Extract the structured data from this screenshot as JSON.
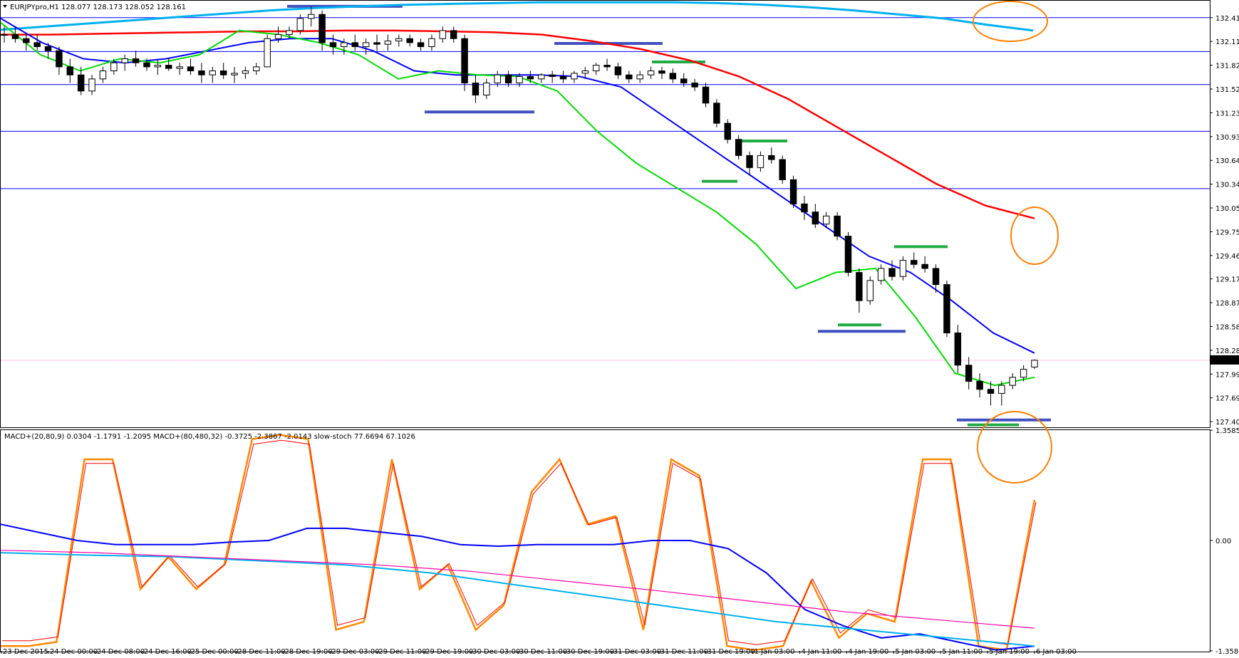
{
  "main_title": "EURJPYpro,H1  128.077 128.173 128.052 128.161",
  "price_axis_labels": [
    "132.410",
    "132.115",
    "131.820",
    "131.525",
    "131.230",
    "130.935",
    "130.640",
    "130.345",
    "130.050",
    "129.755",
    "129.460",
    "129.170",
    "128.875",
    "128.580",
    "128.285",
    "127.990",
    "127.695",
    "127.400"
  ],
  "current_price": "128.161",
  "indicator_title": "MACD+(20,80,9) 0.0304 -1.1791 -1.2095  MACD+(80,480,32) -0.3725 -2.3867 -2.0143  slow-stoch 77.6694 67.1026",
  "indicator_axis_labels": [
    "1.3585",
    "0.00",
    "-1.3585"
  ],
  "time_labels": [
    "23 Dec 2015",
    "24 Dec 00:00",
    "24 Dec 08:00",
    "24 Dec 16:00",
    "25 Dec 00:00",
    "28 Dec 11:00",
    "28 Dec 19:00",
    "29 Dec 03:00",
    "29 Dec 11:00",
    "29 Dec 19:00",
    "30 Dec 03:00",
    "30 Dec 11:00",
    "30 Dec 19:00",
    "31 Dec 03:00",
    "31 Dec 11:00",
    "31 Dec 19:00",
    "1 Jan 03:00",
    "4 Jan 11:00",
    "4 Jan 19:00",
    "5 Jan 03:00",
    "5 Jan 11:00",
    "5 Jan 19:00",
    "6 Jan 03:00"
  ],
  "colors": {
    "bull_candle": "#ffffff",
    "bear_candle": "#000000",
    "ema_fast": "#00dd00",
    "ema_mid": "#0000ff",
    "ema_slow": "#ff0000",
    "ma_long": "#00b0f0",
    "bands": "#0000ff",
    "levels": "#0000ff",
    "resistance_marks": "#4050c0",
    "support_marks": "#22aa44",
    "highlight_circles": "#ff7f00",
    "stoch_main": "#ff8800",
    "stoch_signal": "#ff0000",
    "macd_slow_signal": "#ff00aa",
    "price_line": "#ff88cc"
  },
  "chart_data": [
    {
      "type": "candlestick",
      "title": "EURJPYpro,H1",
      "ylim": [
        127.33,
        132.62
      ],
      "levels": [
        132.41,
        131.99,
        131.58,
        131.0,
        130.29
      ],
      "candles": [
        [
          132.2,
          132.3,
          132.1,
          132.2
        ],
        [
          132.2,
          132.3,
          132.1,
          132.15
        ],
        [
          132.15,
          132.2,
          132.0,
          132.1
        ],
        [
          132.1,
          132.2,
          132.0,
          132.05
        ],
        [
          132.05,
          132.1,
          131.9,
          132.0
        ],
        [
          132.0,
          132.05,
          131.7,
          131.8
        ],
        [
          131.8,
          131.9,
          131.6,
          131.7
        ],
        [
          131.7,
          131.8,
          131.45,
          131.5
        ],
        [
          131.5,
          131.7,
          131.45,
          131.65
        ],
        [
          131.65,
          131.8,
          131.6,
          131.75
        ],
        [
          131.75,
          131.9,
          131.7,
          131.85
        ],
        [
          131.85,
          131.95,
          131.75,
          131.9
        ],
        [
          131.9,
          132.0,
          131.8,
          131.85
        ],
        [
          131.85,
          131.9,
          131.75,
          131.8
        ],
        [
          131.8,
          131.9,
          131.7,
          131.82
        ],
        [
          131.82,
          131.9,
          131.75,
          131.78
        ],
        [
          131.78,
          131.85,
          131.7,
          131.8
        ],
        [
          131.8,
          131.9,
          131.7,
          131.75
        ],
        [
          131.75,
          131.85,
          131.6,
          131.7
        ],
        [
          131.7,
          131.8,
          131.6,
          131.75
        ],
        [
          131.75,
          131.85,
          131.65,
          131.7
        ],
        [
          131.7,
          131.8,
          131.6,
          131.72
        ],
        [
          131.72,
          131.8,
          131.65,
          131.75
        ],
        [
          131.75,
          131.85,
          131.7,
          131.8
        ],
        [
          131.8,
          132.2,
          131.8,
          132.15
        ],
        [
          132.15,
          132.3,
          132.1,
          132.2
        ],
        [
          132.2,
          132.3,
          132.15,
          132.25
        ],
        [
          132.25,
          132.45,
          132.2,
          132.4
        ],
        [
          132.4,
          132.55,
          132.3,
          132.45
        ],
        [
          132.45,
          132.5,
          132.0,
          132.1
        ],
        [
          132.1,
          132.2,
          131.95,
          132.05
        ],
        [
          132.05,
          132.15,
          131.95,
          132.1
        ],
        [
          132.1,
          132.2,
          132.0,
          132.05
        ],
        [
          132.05,
          132.15,
          131.95,
          132.1
        ],
        [
          132.1,
          132.2,
          132.0,
          132.08
        ],
        [
          132.08,
          132.2,
          132.0,
          132.12
        ],
        [
          132.12,
          132.2,
          132.05,
          132.15
        ],
        [
          132.15,
          132.2,
          132.05,
          132.1
        ],
        [
          132.1,
          132.15,
          132.0,
          132.05
        ],
        [
          132.05,
          132.2,
          132.0,
          132.15
        ],
        [
          132.15,
          132.3,
          132.1,
          132.25
        ],
        [
          132.25,
          132.3,
          132.1,
          132.15
        ],
        [
          132.15,
          132.2,
          131.5,
          131.6
        ],
        [
          131.6,
          131.7,
          131.35,
          131.45
        ],
        [
          131.45,
          131.65,
          131.4,
          131.6
        ],
        [
          131.6,
          131.75,
          131.55,
          131.7
        ],
        [
          131.7,
          131.75,
          131.55,
          131.6
        ],
        [
          131.6,
          131.72,
          131.55,
          131.68
        ],
        [
          131.68,
          131.75,
          131.6,
          131.65
        ],
        [
          131.65,
          131.72,
          131.6,
          131.7
        ],
        [
          131.7,
          131.75,
          131.6,
          131.68
        ],
        [
          131.68,
          131.75,
          131.6,
          131.65
        ],
        [
          131.65,
          131.75,
          131.6,
          131.72
        ],
        [
          131.72,
          131.8,
          131.65,
          131.75
        ],
        [
          131.75,
          131.85,
          131.7,
          131.82
        ],
        [
          131.82,
          131.9,
          131.75,
          131.8
        ],
        [
          131.8,
          131.85,
          131.65,
          131.7
        ],
        [
          131.7,
          131.75,
          131.6,
          131.65
        ],
        [
          131.65,
          131.75,
          131.6,
          131.7
        ],
        [
          131.7,
          131.8,
          131.65,
          131.75
        ],
        [
          131.75,
          131.8,
          131.65,
          131.72
        ],
        [
          131.72,
          131.78,
          131.6,
          131.65
        ],
        [
          131.65,
          131.72,
          131.55,
          131.6
        ],
        [
          131.6,
          131.65,
          131.5,
          131.55
        ],
        [
          131.55,
          131.6,
          131.3,
          131.35
        ],
        [
          131.35,
          131.4,
          131.05,
          131.1
        ],
        [
          131.1,
          131.15,
          130.85,
          130.9
        ],
        [
          130.9,
          130.95,
          130.65,
          130.7
        ],
        [
          130.7,
          130.75,
          130.45,
          130.55
        ],
        [
          130.55,
          130.75,
          130.5,
          130.7
        ],
        [
          130.7,
          130.8,
          130.6,
          130.65
        ],
        [
          130.65,
          130.7,
          130.35,
          130.4
        ],
        [
          130.4,
          130.45,
          130.05,
          130.1
        ],
        [
          130.1,
          130.2,
          129.9,
          130.0
        ],
        [
          130.0,
          130.1,
          129.8,
          129.85
        ],
        [
          129.85,
          130.0,
          129.8,
          129.95
        ],
        [
          129.95,
          130.0,
          129.65,
          129.7
        ],
        [
          129.7,
          129.75,
          129.2,
          129.25
        ],
        [
          129.25,
          129.3,
          128.75,
          128.9
        ],
        [
          128.9,
          129.2,
          128.85,
          129.15
        ],
        [
          129.15,
          129.35,
          129.1,
          129.3
        ],
        [
          129.3,
          129.4,
          129.15,
          129.2
        ],
        [
          129.2,
          129.45,
          129.15,
          129.4
        ],
        [
          129.4,
          129.5,
          129.3,
          129.35
        ],
        [
          129.35,
          129.45,
          129.25,
          129.3
        ],
        [
          129.3,
          129.35,
          129.0,
          129.1
        ],
        [
          129.1,
          129.15,
          128.45,
          128.5
        ],
        [
          128.5,
          128.6,
          128.0,
          128.1
        ],
        [
          128.1,
          128.2,
          127.8,
          127.9
        ],
        [
          127.9,
          128.0,
          127.7,
          127.8
        ],
        [
          127.8,
          127.9,
          127.6,
          127.75
        ],
        [
          127.75,
          127.9,
          127.6,
          127.85
        ],
        [
          127.85,
          128.0,
          127.8,
          127.95
        ],
        [
          127.95,
          128.1,
          127.9,
          128.05
        ],
        [
          128.077,
          128.173,
          128.052,
          128.161
        ]
      ],
      "ma_slow": [
        132.2,
        132.2,
        132.21,
        132.22,
        132.23,
        132.24,
        132.24,
        132.25,
        132.25,
        132.24,
        132.23,
        132.2,
        132.12,
        132.02,
        131.88,
        131.68,
        131.4,
        131.05,
        130.7,
        130.35,
        130.08,
        129.92
      ],
      "ma_long": [
        132.26,
        132.3,
        132.34,
        132.38,
        132.42,
        132.46,
        132.5,
        132.53,
        132.55,
        132.57,
        132.58,
        132.59,
        132.6,
        132.6,
        132.6,
        132.6,
        132.59,
        132.57,
        132.54,
        132.5,
        132.45,
        132.4,
        132.32,
        132.25
      ],
      "ema_mid": [
        132.4,
        132.1,
        131.9,
        131.85,
        131.9,
        132.0,
        132.1,
        132.15,
        132.15,
        132.0,
        131.75,
        131.7,
        131.7,
        131.7,
        131.68,
        131.55,
        131.2,
        130.85,
        130.5,
        130.15,
        129.8,
        129.45,
        129.25,
        128.9,
        128.5,
        128.25
      ],
      "ema_fast": [
        132.35,
        131.95,
        131.75,
        131.9,
        131.85,
        131.95,
        132.25,
        132.2,
        132.1,
        131.95,
        131.65,
        131.75,
        131.7,
        131.68,
        131.5,
        131.0,
        130.6,
        130.3,
        130.0,
        129.6,
        129.05,
        129.25,
        129.3,
        128.7,
        128.0,
        127.85,
        127.95
      ]
    },
    {
      "type": "line",
      "title": "MACD+(20,80,9) / MACD+(80,480,32) / slow-stoch",
      "ylim": [
        -1.36,
        1.36
      ],
      "series": [
        {
          "name": "slow-stoch",
          "values": [
            -1.3,
            -1.3,
            -1.25,
            1.0,
            1.0,
            -0.6,
            -0.2,
            -0.6,
            -0.3,
            1.25,
            1.3,
            1.25,
            -1.1,
            -1.0,
            1.0,
            -0.6,
            -0.3,
            -1.1,
            -0.8,
            0.6,
            1.0,
            0.2,
            0.3,
            -1.1,
            1.0,
            0.8,
            -1.3,
            -1.35,
            -1.3,
            -0.5,
            -1.2,
            -0.9,
            -1.0,
            1.0,
            1.0,
            -1.3,
            -1.35,
            0.5
          ]
        },
        {
          "name": "MACD+(20,80,9)",
          "values": [
            0.2,
            0.1,
            0.0,
            -0.05,
            -0.05,
            -0.05,
            -0.02,
            0.0,
            0.15,
            0.15,
            0.1,
            0.05,
            -0.05,
            -0.07,
            -0.05,
            -0.05,
            -0.05,
            0.0,
            0.0,
            -0.1,
            -0.4,
            -0.85,
            -1.05,
            -1.2,
            -1.15,
            -1.25,
            -1.35,
            -1.3
          ]
        }
      ]
    }
  ]
}
